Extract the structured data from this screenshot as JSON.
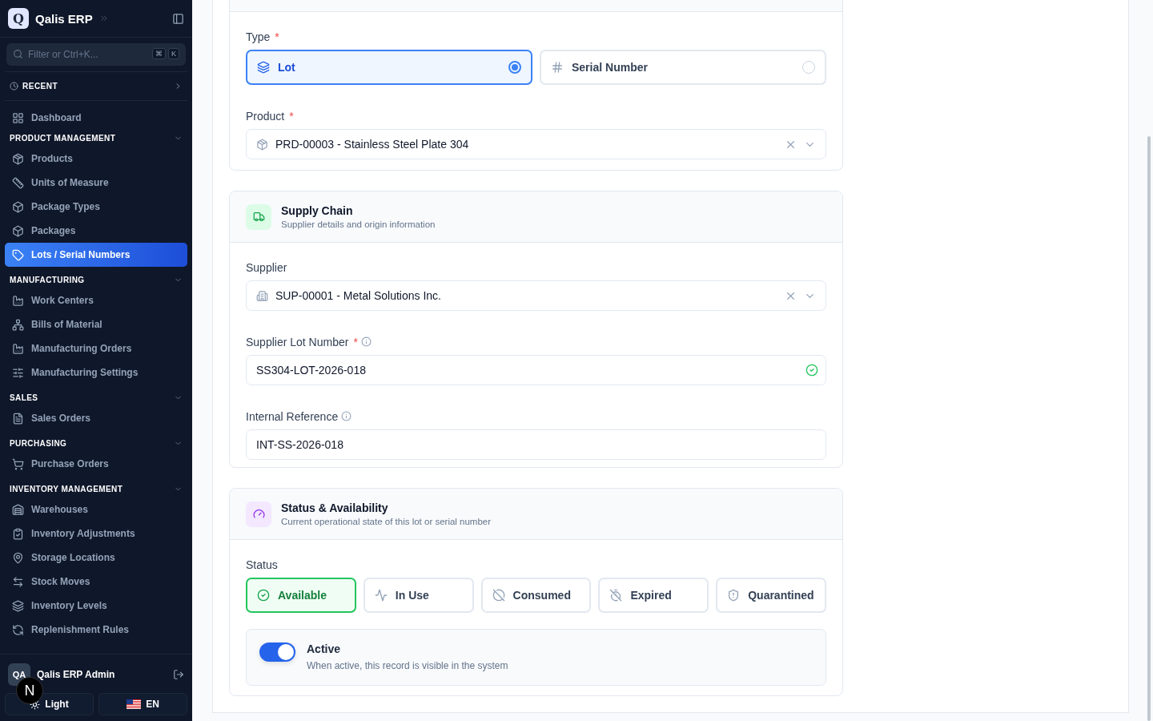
{
  "sidebar": {
    "brand": {
      "logo": "Q",
      "name": "Qalis ERP"
    },
    "filter": {
      "placeholder": "Filter or Ctrl+K...",
      "keys": [
        "⌘",
        "K"
      ]
    },
    "recent": "RECENT",
    "top_items": [
      {
        "label": "Dashboard",
        "selected": false
      }
    ],
    "groups": [
      {
        "title": "PRODUCT MANAGEMENT",
        "expanded": true,
        "items": [
          {
            "label": "Products",
            "selected": false
          },
          {
            "label": "Units of Measure",
            "selected": false
          },
          {
            "label": "Package Types",
            "selected": false
          },
          {
            "label": "Packages",
            "selected": false
          },
          {
            "label": "Lots / Serial Numbers",
            "selected": true
          }
        ]
      },
      {
        "title": "MANUFACTURING",
        "expanded": true,
        "items": [
          {
            "label": "Work Centers",
            "selected": false
          },
          {
            "label": "Bills of Material",
            "selected": false
          },
          {
            "label": "Manufacturing Orders",
            "selected": false
          },
          {
            "label": "Manufacturing Settings",
            "selected": false
          }
        ]
      },
      {
        "title": "SALES",
        "expanded": true,
        "items": [
          {
            "label": "Sales Orders",
            "selected": false
          }
        ]
      },
      {
        "title": "PURCHASING",
        "expanded": true,
        "items": [
          {
            "label": "Purchase Orders",
            "selected": false
          }
        ]
      },
      {
        "title": "INVENTORY MANAGEMENT",
        "expanded": true,
        "items": [
          {
            "label": "Warehouses",
            "selected": false
          },
          {
            "label": "Inventory Adjustments",
            "selected": false
          },
          {
            "label": "Storage Locations",
            "selected": false
          },
          {
            "label": "Stock Moves",
            "selected": false
          },
          {
            "label": "Inventory Levels",
            "selected": false
          },
          {
            "label": "Replenishment Rules",
            "selected": false
          }
        ]
      }
    ],
    "user": {
      "initials": "QA",
      "name": "Qalis ERP Admin"
    },
    "theme_button": "Light",
    "language_button": "EN",
    "dev_badge": "N"
  },
  "identity_card": {
    "type": {
      "label": "Type",
      "required_mark": "*",
      "options": [
        {
          "label": "Lot",
          "selected": true
        },
        {
          "label": "Serial Number",
          "selected": false
        }
      ]
    },
    "product": {
      "label": "Product",
      "required_mark": "*",
      "value": "PRD-00003 - Stainless Steel Plate 304"
    }
  },
  "supply_chain": {
    "title": "Supply Chain",
    "subtitle": "Supplier details and origin information",
    "supplier": {
      "label": "Supplier",
      "value": "SUP-00001 - Metal Solutions Inc."
    },
    "supplier_lot_number": {
      "label": "Supplier Lot Number",
      "required_mark": "*",
      "value": "SS304-LOT-2026-018",
      "valid": true
    },
    "internal_reference": {
      "label": "Internal Reference",
      "value": "INT-SS-2026-018"
    }
  },
  "status_card": {
    "title": "Status & Availability",
    "subtitle": "Current operational state of this lot or serial number",
    "status": {
      "label": "Status",
      "options": [
        {
          "label": "Available",
          "selected": true
        },
        {
          "label": "In Use",
          "selected": false
        },
        {
          "label": "Consumed",
          "selected": false
        },
        {
          "label": "Expired",
          "selected": false
        },
        {
          "label": "Quarantined",
          "selected": false
        }
      ]
    },
    "active": {
      "label": "Active",
      "description": "When active, this record is visible in the system",
      "on": true
    }
  }
}
